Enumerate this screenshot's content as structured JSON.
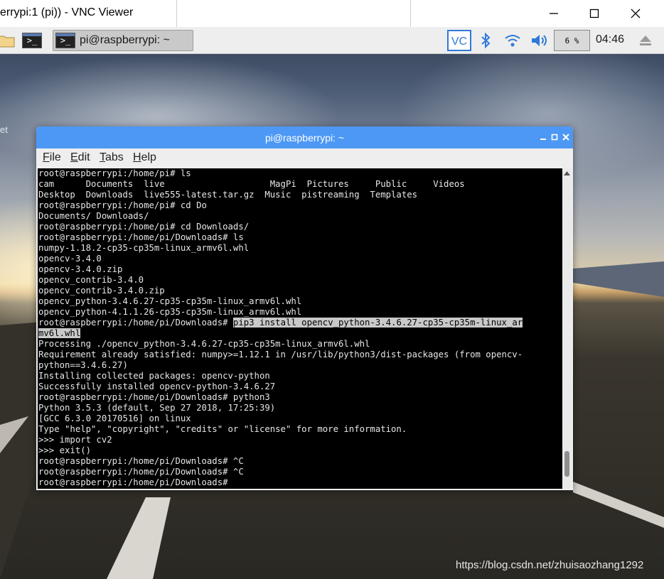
{
  "vnc": {
    "title": "errypi:1 (pi)) - VNC Viewer",
    "minimize_icon": "minimize-icon",
    "maximize_icon": "maximize-icon",
    "close_icon": "close-icon"
  },
  "taskbar": {
    "terminal_task_label": "pi@raspberrypi: ~",
    "cpu_usage": "6 %",
    "clock": "04:46",
    "icons": [
      "folder-icon",
      "terminal-icon",
      "vnc-icon",
      "bluetooth-icon",
      "wifi-icon",
      "volume-icon",
      "eject-icon"
    ]
  },
  "desktop": {
    "fragment": "et"
  },
  "terminal": {
    "title": "pi@raspberrypi: ~",
    "menu": {
      "file": {
        "u": "F",
        "rest": "ile"
      },
      "edit": {
        "u": "E",
        "rest": "dit"
      },
      "tabs": {
        "u": "T",
        "rest": "abs"
      },
      "help": {
        "u": "H",
        "rest": "elp"
      }
    },
    "lines_before": "root@raspberrypi:/home/pi# ls\ncam      Documents  live                    MagPi  Pictures     Public     Videos\nDesktop  Downloads  live555-latest.tar.gz  Music  pistreaming  Templates\nroot@raspberrypi:/home/pi# cd Do\nDocuments/ Downloads/\nroot@raspberrypi:/home/pi# cd Downloads/\nroot@raspberrypi:/home/pi/Downloads# ls\nnumpy-1.18.2-cp35-cp35m-linux_armv6l.whl\nopencv-3.4.0\nopencv-3.4.0.zip\nopencv_contrib-3.4.0\nopencv_contrib-3.4.0.zip\nopencv_python-3.4.6.27-cp35-cp35m-linux_armv6l.whl\nopencv_python-4.1.1.26-cp35-cp35m-linux_armv6l.whl\n",
    "prompt_highlight_line": "root@raspberrypi:/home/pi/Downloads# ",
    "highlight_part1": "pip3 install opencv_python-3.4.6.27-cp35-cp35m-linux_ar",
    "highlight_part2": "mv6l.whl",
    "lines_after": "\nProcessing ./opencv_python-3.4.6.27-cp35-cp35m-linux_armv6l.whl\nRequirement already satisfied: numpy>=1.12.1 in /usr/lib/python3/dist-packages (from opencv-\npython==3.4.6.27)\nInstalling collected packages: opencv-python\nSuccessfully installed opencv-python-3.4.6.27\nroot@raspberrypi:/home/pi/Downloads# python3\nPython 3.5.3 (default, Sep 27 2018, 17:25:39)\n[GCC 6.3.0 20170516] on linux\nType \"help\", \"copyright\", \"credits\" or \"license\" for more information.\n>>> import cv2\n>>> exit()\nroot@raspberrypi:/home/pi/Downloads# ^C\nroot@raspberrypi:/home/pi/Downloads# ^C\nroot@raspberrypi:/home/pi/Downloads# "
  },
  "watermark": "https://blog.csdn.net/zhuisaozhang1292",
  "colors": {
    "terminal_title_bar": "#4d98f5",
    "terminal_bg": "#000000",
    "terminal_fg": "#e6e6e6",
    "selection": "#c9c9c9"
  }
}
